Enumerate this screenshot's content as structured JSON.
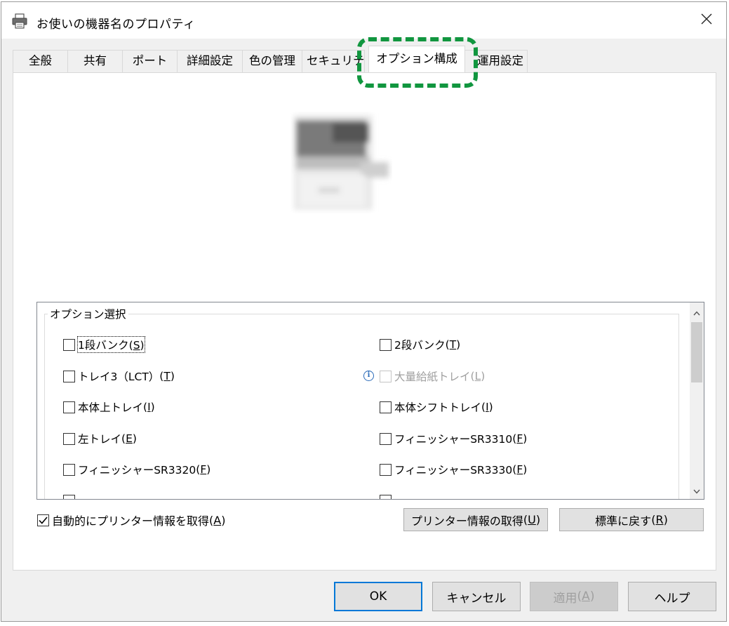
{
  "window": {
    "title": "お使いの機器名のプロパティ"
  },
  "tabs": [
    {
      "label": "全般"
    },
    {
      "label": "共有"
    },
    {
      "label": "ポート"
    },
    {
      "label": "詳細設定"
    },
    {
      "label": "色の管理"
    },
    {
      "label": "セキュリティ"
    },
    {
      "label": "オプション構成",
      "active": true
    },
    {
      "label": "運用設定"
    }
  ],
  "highlight": {
    "color": "#11963f",
    "style": "dashed"
  },
  "options_group": {
    "label": "オプション選択",
    "items": [
      {
        "text": "1段バンク",
        "key": "S",
        "checked": false,
        "enabled": true
      },
      {
        "text": "2段バンク",
        "key": "T",
        "checked": false,
        "enabled": true
      },
      {
        "text": "トレイ3（LCT）",
        "key": "T",
        "checked": false,
        "enabled": true
      },
      {
        "text": "大量給紙トレイ",
        "key": "L",
        "checked": false,
        "enabled": false,
        "info_icon": true
      },
      {
        "text": "本体上トレイ",
        "key": "I",
        "checked": false,
        "enabled": true
      },
      {
        "text": "本体シフトトレイ",
        "key": "I",
        "checked": false,
        "enabled": true
      },
      {
        "text": "左トレイ",
        "key": "E",
        "checked": false,
        "enabled": true
      },
      {
        "text": "フィニッシャーSR3310",
        "key": "F",
        "checked": false,
        "enabled": true
      },
      {
        "text": "フィニッシャーSR3320",
        "key": "F",
        "checked": false,
        "enabled": true
      },
      {
        "text": "フィニッシャーSR3330",
        "key": "F",
        "checked": false,
        "enabled": true
      }
    ]
  },
  "auto_acquire": {
    "text": "自動的にプリンター情報を取得",
    "key": "A",
    "checked": true
  },
  "buttons": {
    "get_info": {
      "text": "プリンター情報の取得",
      "key": "U"
    },
    "restore_default": {
      "text": "標準に戻す",
      "key": "R"
    },
    "ok": "OK",
    "cancel": "キャンセル",
    "apply": {
      "text": "適用",
      "key": "A"
    },
    "help": "ヘルプ"
  },
  "icons": {
    "title": "printer-icon",
    "close": "close-icon",
    "info": "info-icon",
    "scroll_up": "chevron-up-icon",
    "scroll_down": "chevron-down-icon",
    "check": "checkmark-icon"
  }
}
